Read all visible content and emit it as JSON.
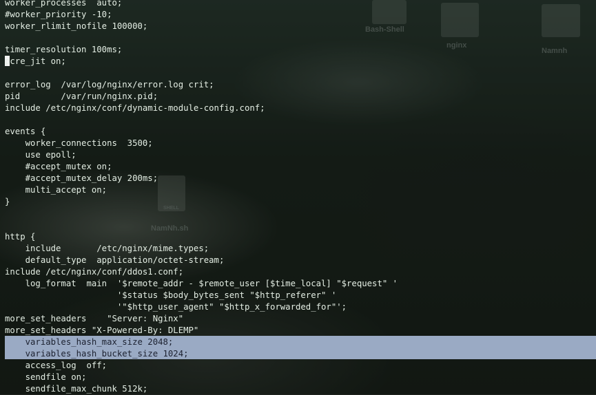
{
  "desktop": {
    "icons": [
      {
        "name": "Bash-Shell",
        "icon": "folder-icon"
      },
      {
        "name": "nginx",
        "icon": "folder-icon"
      },
      {
        "name": "Namnh",
        "icon": "folder-icon"
      },
      {
        "name": "NamNh.sh",
        "icon": "shell-script-file-icon",
        "badge": "SHELL"
      }
    ]
  },
  "terminal": {
    "cursor_line": 4,
    "selected_lines": [
      29,
      30
    ],
    "lines": [
      "worker_processes  auto;",
      "#worker_priority -10;",
      "worker_rlimit_nofile 100000;",
      "",
      "timer_resolution 100ms;",
      "pcre_jit on;",
      "",
      "error_log  /var/log/nginx/error.log crit;",
      "pid        /var/run/nginx.pid;",
      "include /etc/nginx/conf/dynamic-module-config.conf;",
      "",
      "events {",
      "    worker_connections  3500;",
      "    use epoll;",
      "    #accept_mutex on;",
      "    #accept_mutex_delay 200ms;",
      "    multi_accept on;",
      "}",
      "",
      "",
      "http {",
      "    include       /etc/nginx/mime.types;",
      "    default_type  application/octet-stream;",
      "include /etc/nginx/conf/ddos1.conf;",
      "    log_format  main  '$remote_addr - $remote_user [$time_local] \"$request\" '",
      "                      '$status $body_bytes_sent \"$http_referer\" '",
      "                      '\"$http_user_agent\" \"$http_x_forwarded_for\"';",
      "more_set_headers    \"Server: Nginx\"",
      "more_set_headers \"X-Powered-By: DLEMP\"",
      "    variables_hash_max_size 2048;",
      "    variables_hash_bucket_size 1024;",
      "    access_log  off;",
      "    sendfile on;",
      "    sendfile_max_chunk 512k;"
    ]
  }
}
